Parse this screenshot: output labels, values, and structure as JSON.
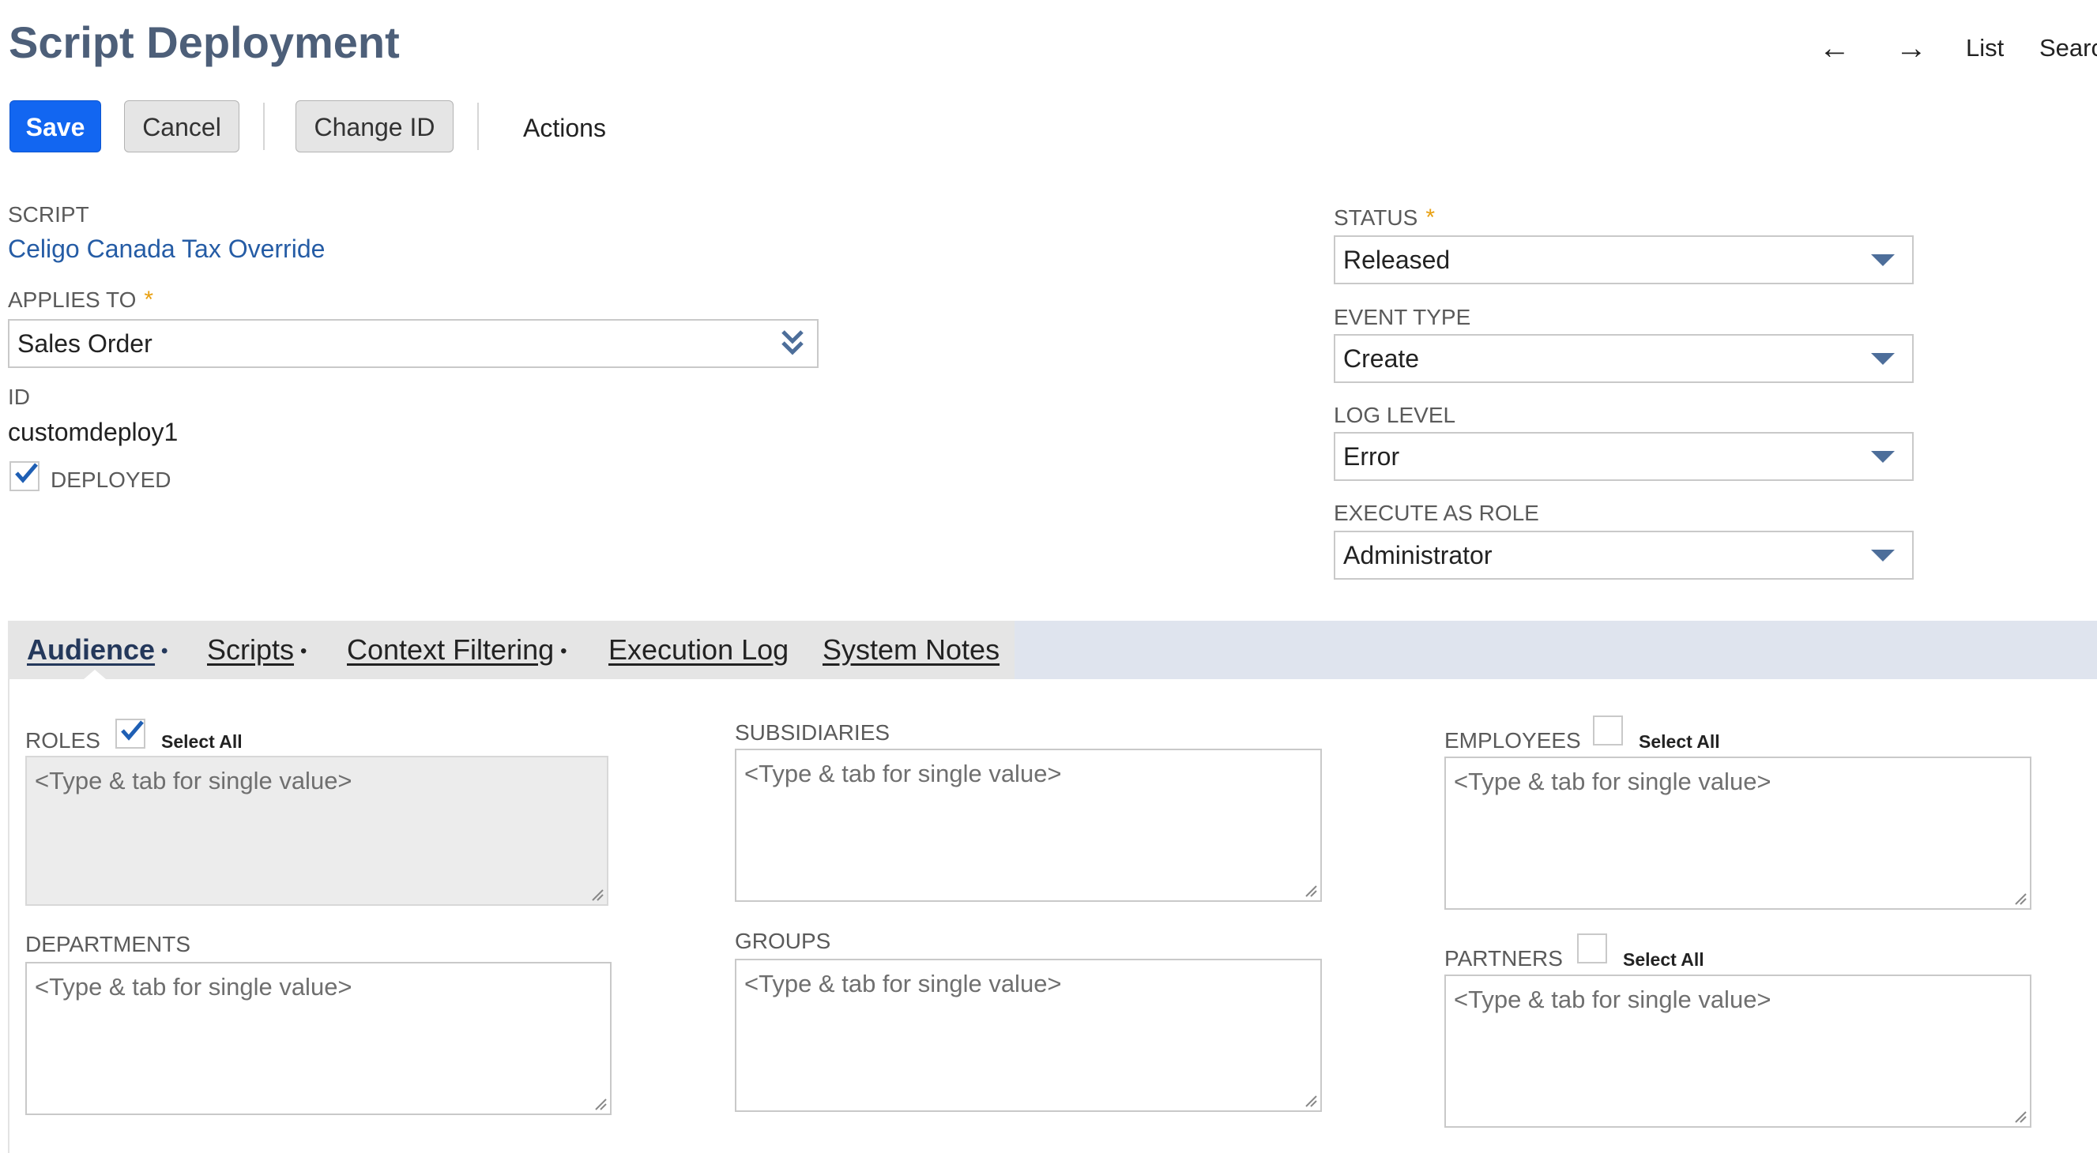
{
  "header": {
    "title": "Script Deployment",
    "nav_back": "←",
    "nav_forward": "→",
    "list_label": "List",
    "search_label": "Search"
  },
  "toolbar": {
    "save_label": "Save",
    "cancel_label": "Cancel",
    "change_id_label": "Change ID",
    "actions_label": "Actions"
  },
  "fields": {
    "script": {
      "label": "SCRIPT",
      "value": "Celigo Canada Tax Override"
    },
    "applies_to": {
      "label": "APPLIES TO",
      "required": "*",
      "value": "Sales Order"
    },
    "id": {
      "label": "ID",
      "value": "customdeploy1"
    },
    "deployed": {
      "label": "DEPLOYED",
      "checked": true
    },
    "status": {
      "label": "STATUS",
      "required": "*",
      "value": "Released"
    },
    "event_type": {
      "label": "EVENT TYPE",
      "value": "Create"
    },
    "log_level": {
      "label": "LOG LEVEL",
      "value": "Error"
    },
    "execute_as_role": {
      "label": "EXECUTE AS ROLE",
      "value": "Administrator"
    }
  },
  "tabs": [
    {
      "label": "Audience",
      "dot": "•",
      "active": true
    },
    {
      "label": "Scripts",
      "dot": "•"
    },
    {
      "label": "Context Filtering",
      "dot": "•"
    },
    {
      "label": "Execution Log",
      "dot": ""
    },
    {
      "label": "System Notes",
      "dot": ""
    }
  ],
  "audience": {
    "placeholder": "<Type & tab for single value>",
    "select_all_label": "Select All",
    "roles": {
      "label": "ROLES",
      "select_all_checked": true
    },
    "subsidiaries": {
      "label": "SUBSIDIARIES"
    },
    "employees": {
      "label": "EMPLOYEES",
      "select_all_checked": false
    },
    "departments": {
      "label": "DEPARTMENTS"
    },
    "groups": {
      "label": "GROUPS"
    },
    "partners": {
      "label": "PARTNERS",
      "select_all_checked": false
    }
  },
  "colors": {
    "title": "#4d5f79",
    "primary_button": "#1266f1",
    "link": "#255ca5",
    "required_star": "#e8a012",
    "check_mark": "#1f5fb4",
    "tab_bar": "#dfe4ee"
  }
}
